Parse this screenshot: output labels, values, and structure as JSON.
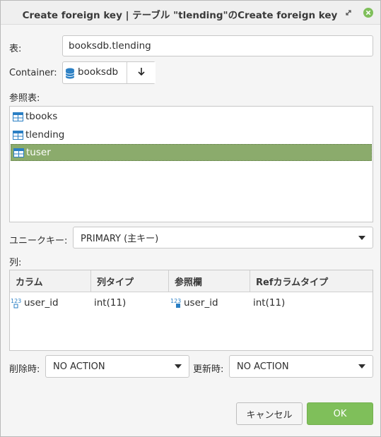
{
  "window": {
    "title": "Create foreign key | テーブル \"tlending\"のCreate foreign key"
  },
  "form": {
    "table_label": "表:",
    "table_value": "booksdb.tlending",
    "container_label": "Container:",
    "container_value": "booksdb",
    "ref_table_label": "参照表:",
    "ref_tables": [
      {
        "name": "tbooks",
        "selected": false
      },
      {
        "name": "tlending",
        "selected": false
      },
      {
        "name": "tuser",
        "selected": true
      }
    ],
    "unique_key_label": "ユニークキー:",
    "unique_key_value": "PRIMARY (主キー)",
    "columns_label": "列:",
    "columns_headers": [
      "カラム",
      "列タイプ",
      "参照欄",
      "Refカラムタイプ"
    ],
    "columns_rows": [
      {
        "column": "user_id",
        "type": "int(11)",
        "ref_column": "user_id",
        "ref_type": "int(11)"
      }
    ],
    "on_delete_label": "削除時:",
    "on_delete_value": "NO ACTION",
    "on_update_label": "更新時:",
    "on_update_value": "NO ACTION"
  },
  "buttons": {
    "cancel": "キャンセル",
    "ok": "OK"
  },
  "colors": {
    "selection": "#8bab6c",
    "ok_button": "#7fbf5a",
    "table_icon": "#2a7fc4"
  },
  "icons": {
    "close": "close-icon",
    "restore": "restore-icon",
    "database": "database-icon",
    "table": "table-icon",
    "numeric_column": "numeric-column-icon",
    "arrow_down": "arrow-down-icon"
  }
}
